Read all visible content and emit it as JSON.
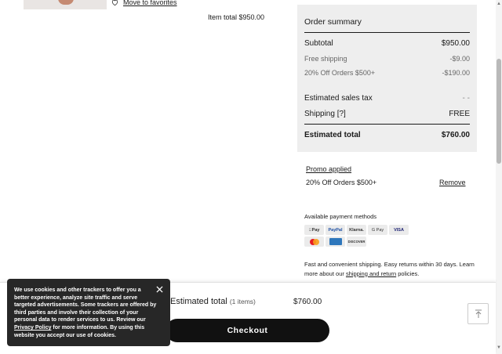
{
  "product": {
    "move_to_favorites": "Move to favorites",
    "item_total_label": "Item total",
    "item_total_value": "$950.00"
  },
  "order_summary": {
    "title": "Order summary",
    "rows": [
      {
        "label": "Subtotal",
        "value": "$950.00"
      },
      {
        "label": "Free shipping",
        "value": "-$9.00"
      },
      {
        "label": "20% Off Orders $500+",
        "value": "-$190.00"
      },
      {
        "label": "Estimated sales tax",
        "value": "- -"
      },
      {
        "label": "Shipping [?]",
        "value": "FREE"
      },
      {
        "label": "Estimated total",
        "value": "$760.00"
      }
    ]
  },
  "promo": {
    "applied_label": "Promo applied",
    "name": "20% Off Orders $500+",
    "remove_label": "Remove"
  },
  "payment": {
    "title": "Available payment methods",
    "methods": [
      "Apple Pay",
      "PayPal",
      "Klarna.",
      "G Pay",
      "VISA",
      "Mastercard",
      "American Express",
      "DISCOVER"
    ]
  },
  "shipping_note": {
    "text_before": "Fast and convenient shipping. Easy returns within 30 days. Learn more about our ",
    "link": "shipping and return",
    "text_after": " policies."
  },
  "bottom_bar": {
    "estimated_total_label": "Estimated total",
    "items_count": "(1 items)",
    "estimated_total_value": "$760.00",
    "checkout_label": "Checkout"
  },
  "cookie_banner": {
    "text_main": "We use cookies and other trackers to offer you a better experience, analyze site traffic and serve targeted advertisements. Some trackers are offered by third parties and involve their collection of your personal data to render services to us. Review our ",
    "link": "Privacy Policy",
    "text_after": " for more information. By using this website you accept our use of cookies."
  },
  "icons": {
    "favorite": "heart-outline-icon",
    "close": "close-icon",
    "scroll_top": "arrow-up-to-line-icon"
  }
}
